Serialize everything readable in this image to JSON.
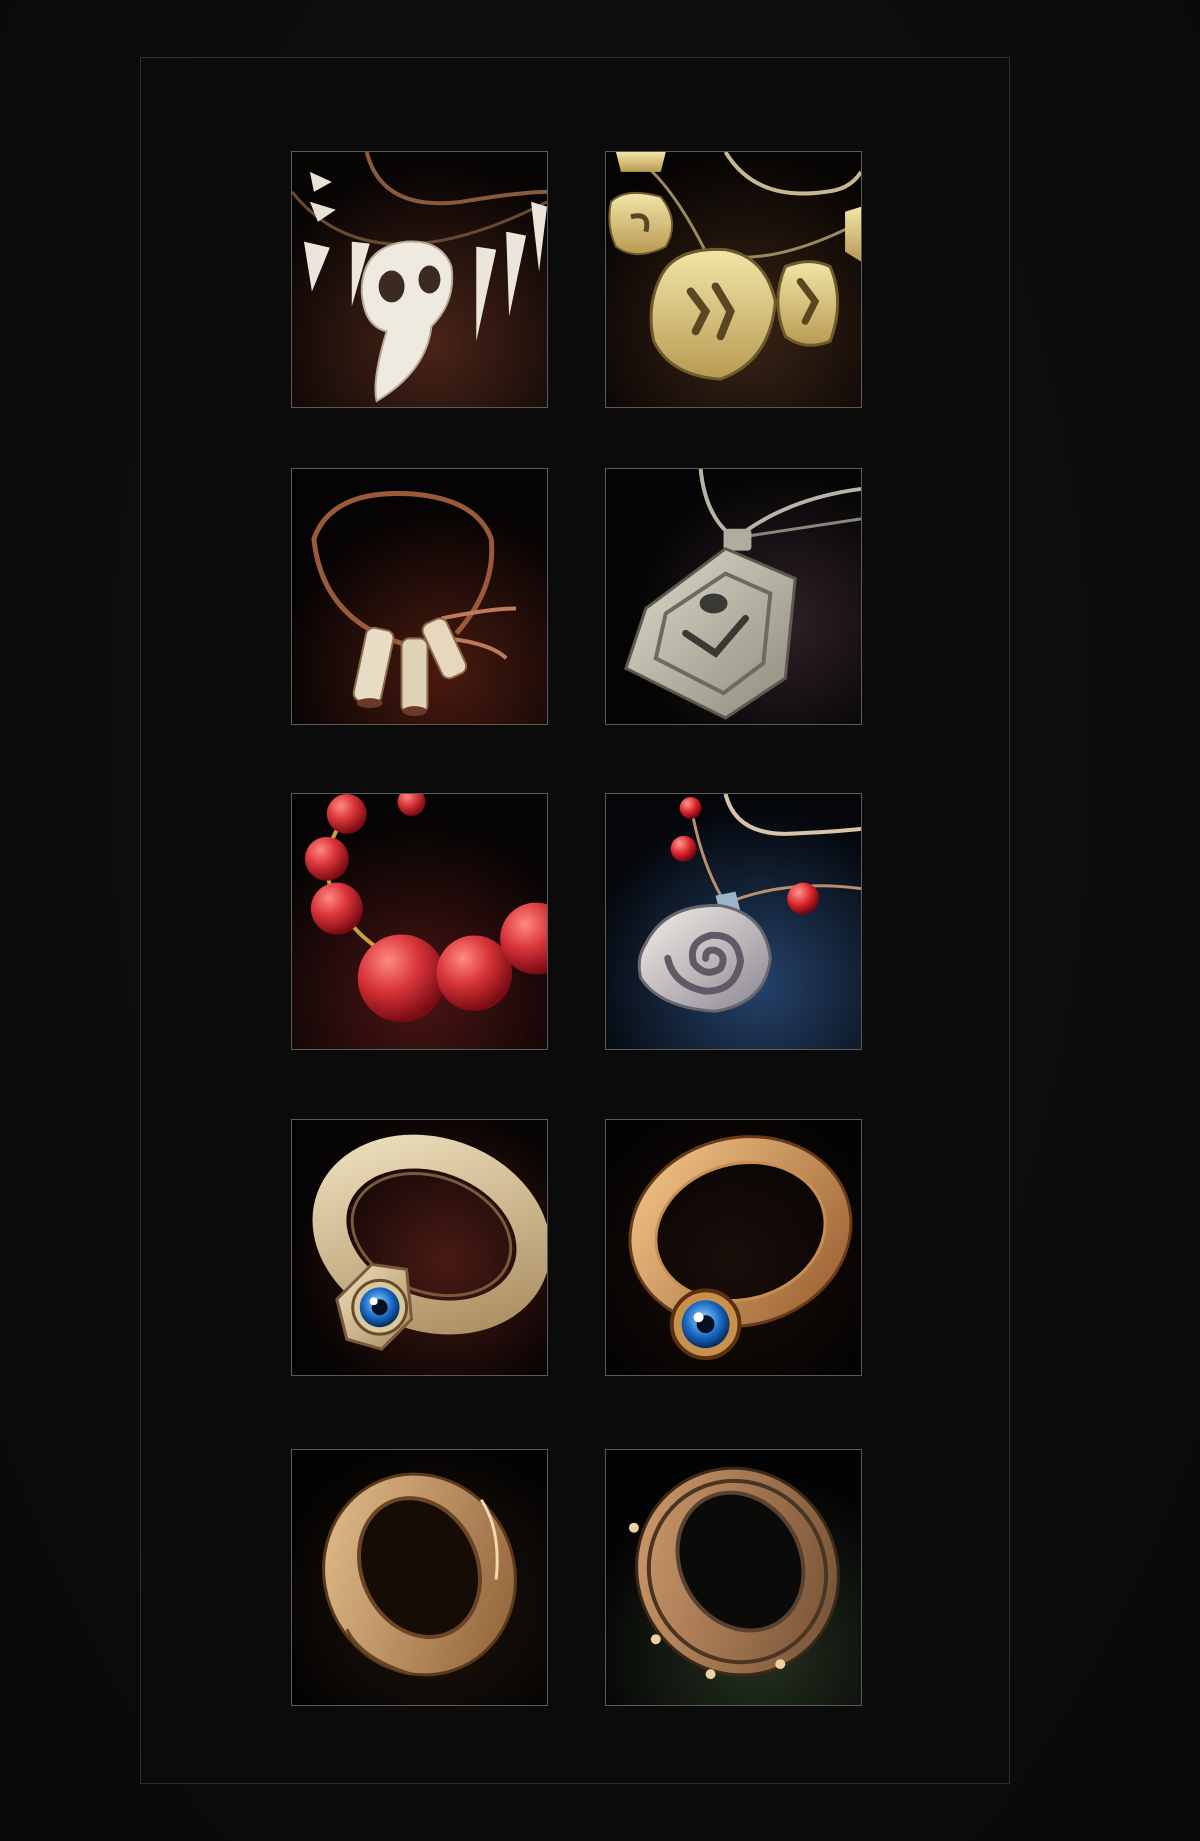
{
  "inventory": {
    "items": [
      {
        "icon": "skull-tooth-necklace-icon",
        "bg": "#3a1a12"
      },
      {
        "icon": "rune-stone-necklace-icon",
        "bg": "#2a1a0e"
      },
      {
        "icon": "bone-tube-necklace-icon",
        "bg": "#3a130c"
      },
      {
        "icon": "stone-amulet-necklace-icon",
        "bg": "#241c22"
      },
      {
        "icon": "red-bead-necklace-icon",
        "bg": "#3b0f0f"
      },
      {
        "icon": "spiral-stone-pendant-icon",
        "bg": "#1a2a44"
      },
      {
        "icon": "bone-eye-ring-icon",
        "bg": "#3a1510"
      },
      {
        "icon": "gold-eye-ring-icon",
        "bg": "#140c08"
      },
      {
        "icon": "wooden-band-ring-icon",
        "bg": "#1a120c"
      },
      {
        "icon": "studded-bronze-ring-icon",
        "bg": "#1b2216"
      }
    ]
  }
}
